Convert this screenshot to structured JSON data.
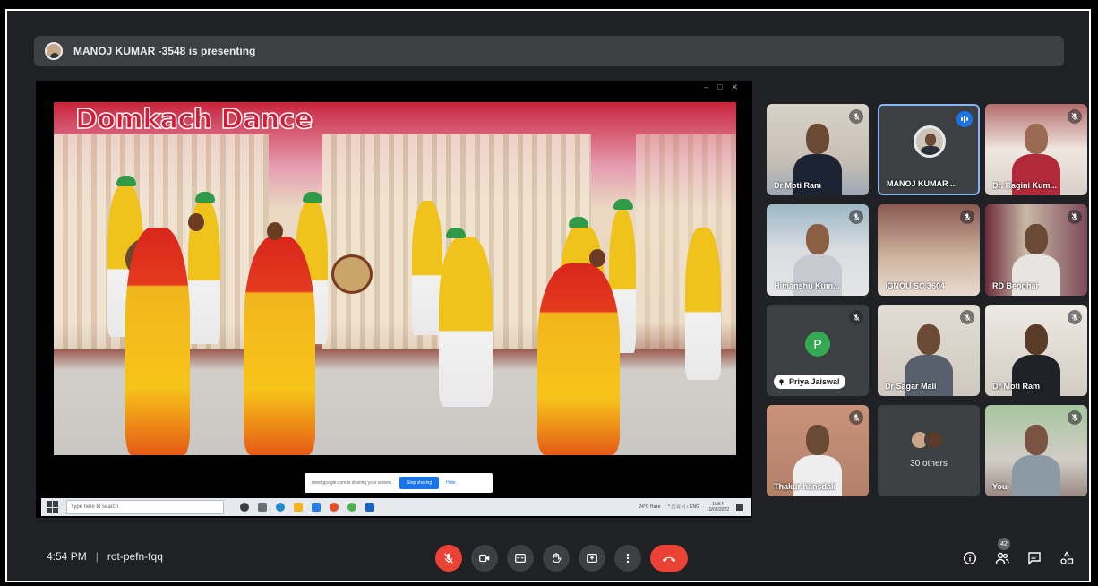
{
  "presenting": {
    "text": "MANOJ KUMAR -3548 is presenting"
  },
  "video": {
    "title": "Domkach Dance"
  },
  "share_banner": {
    "text": "meet.google.com is sharing your screen.",
    "stop_label": "Stop sharing",
    "hide_label": "Hide"
  },
  "taskbar": {
    "search_placeholder": "Type here to search",
    "weather": "24°C Haze",
    "time": "16:54",
    "date": "10/03/2022"
  },
  "participants": [
    {
      "name": "Dr Moti Ram",
      "muted": true
    },
    {
      "name": "MANOJ KUMAR ...",
      "speaking": true
    },
    {
      "name": "Dr. Ragini Kum...",
      "muted": true
    },
    {
      "name": "Himanshu Kum...",
      "muted": true
    },
    {
      "name": "IGNOU SC 3604",
      "muted": true
    },
    {
      "name": "RD Beoghar",
      "muted": true
    },
    {
      "name": "Priya Jaiswal",
      "initial": "P",
      "muted": true
    },
    {
      "name": "Dr Sagar Mali",
      "muted": true
    },
    {
      "name": "Dr Moti Ram",
      "muted": true
    },
    {
      "name": "Thakur hansdak",
      "muted": true
    },
    {
      "name": "30 others"
    },
    {
      "name": "You",
      "muted": true
    }
  ],
  "meeting": {
    "time": "4:54 PM",
    "code": "rot-pefn-fqq"
  },
  "people_count": "42",
  "colors": {
    "background": "#202124",
    "tile": "#3c4043",
    "danger": "#ea4335",
    "accent": "#1a73e8"
  }
}
